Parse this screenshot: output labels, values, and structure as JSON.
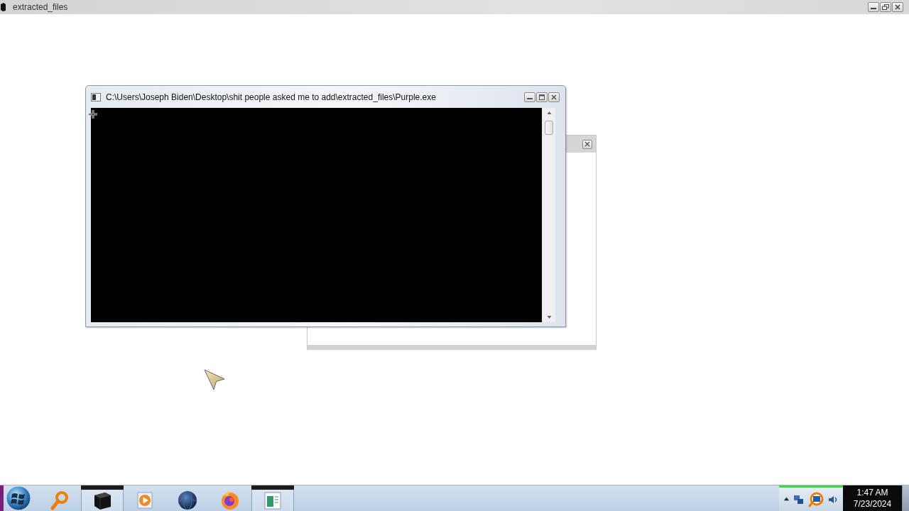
{
  "window": {
    "title": "extracted_files"
  },
  "console": {
    "title": "C:\\Users\\Joseph Biden\\Desktop\\shit people asked me to add\\extracted_files\\Purple.exe"
  },
  "taskbar": {
    "items": [
      {
        "kind": "search",
        "active": false
      },
      {
        "kind": "terminal",
        "active": true
      },
      {
        "kind": "media",
        "active": false
      },
      {
        "kind": "globe",
        "active": false
      },
      {
        "kind": "browser",
        "active": false
      },
      {
        "kind": "document",
        "active": true
      }
    ],
    "clock": {
      "time": "1:47 AM",
      "date": "7/23/2024"
    }
  }
}
